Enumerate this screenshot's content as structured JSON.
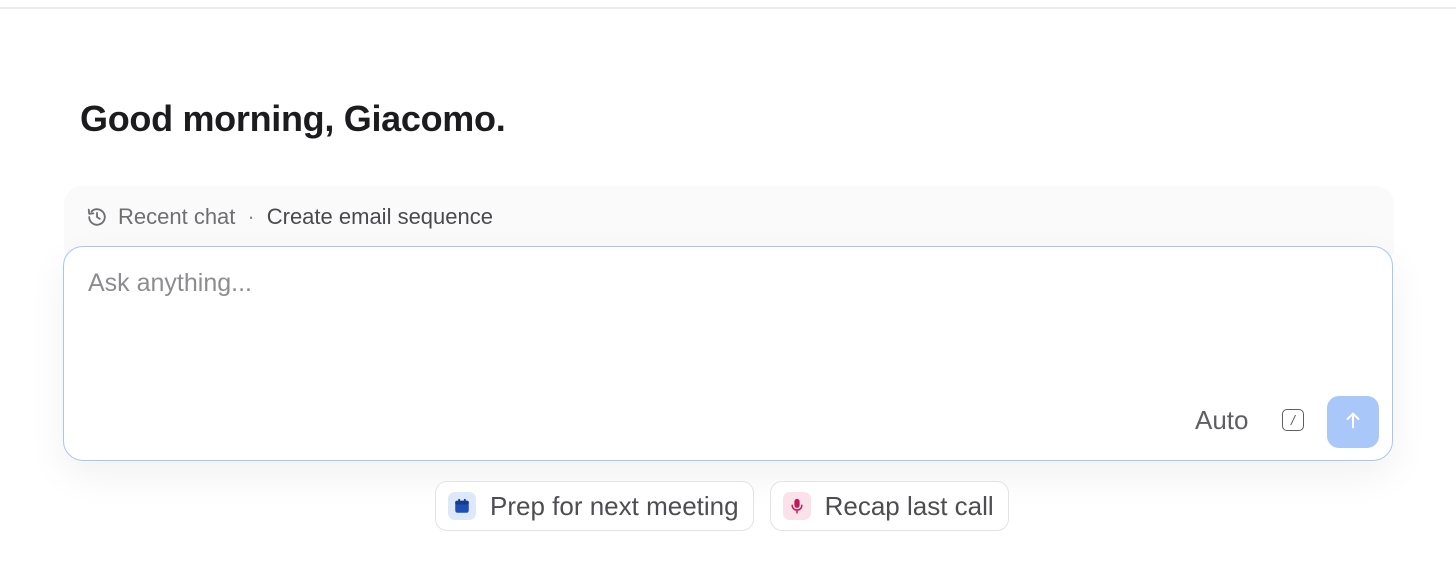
{
  "greeting": "Good morning, Giacomo.",
  "recent": {
    "label": "Recent chat",
    "separator": "·",
    "title": "Create email sequence",
    "icon": "history-icon"
  },
  "composer": {
    "placeholder": "Ask anything...",
    "mode": "Auto",
    "slash_glyph": "/",
    "send_icon": "arrow-up-icon"
  },
  "suggestions": [
    {
      "label": "Prep for next meeting",
      "icon": "calendar-icon",
      "icon_color": "#1f4fb3"
    },
    {
      "label": "Recap last call",
      "icon": "microphone-icon",
      "icon_color": "#c2185b"
    }
  ],
  "colors": {
    "accent": "#aac7f9",
    "border_focus": "#a9c6f3"
  }
}
